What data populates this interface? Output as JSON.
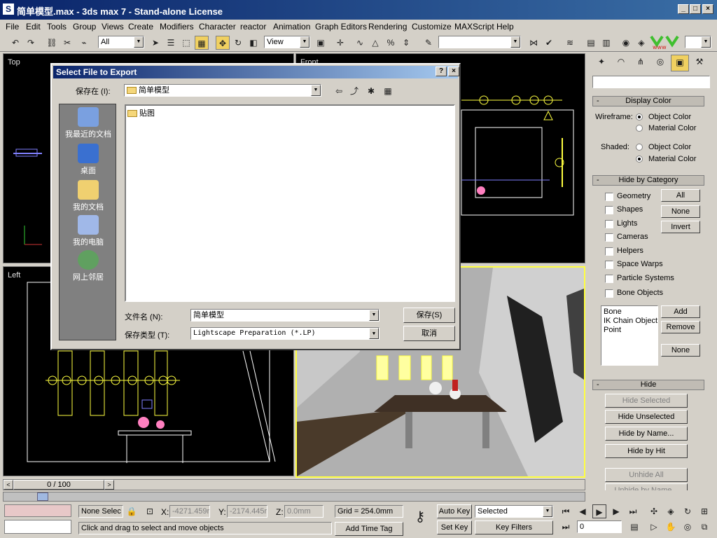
{
  "window": {
    "title": "简单模型.max - 3ds max 7 - Stand-alone License",
    "min": "_",
    "max": "□",
    "close": "×"
  },
  "menu": [
    "File",
    "Edit",
    "Tools",
    "Group",
    "Views",
    "Create",
    "Modifiers",
    "Character",
    "reactor",
    "Animation",
    "Graph Editors",
    "Rendering",
    "Customize",
    "MAXScript",
    "Help"
  ],
  "toolbar": {
    "selection_filter": "All",
    "reference_coord": "View",
    "named_selection": ""
  },
  "viewports": {
    "top": "Top",
    "front": "Front",
    "left": "Left"
  },
  "dialog": {
    "title": "Select File to Export",
    "help": "?",
    "close": "×",
    "save_in_label": "保存在 (I):",
    "save_in_value": "简单模型",
    "places": [
      "我最近的文档",
      "桌面",
      "我的文档",
      "我的电脑",
      "网上邻居"
    ],
    "files": [
      "贴图"
    ],
    "filename_label": "文件名 (N):",
    "filename_value": "简单模型",
    "filetype_label": "保存类型 (T):",
    "filetype_value": "Lightscape Preparation (*.LP)",
    "save_button": "保存(S)",
    "cancel_button": "取消"
  },
  "command_panel": {
    "display_color": {
      "title": "Display Color",
      "wireframe_label": "Wireframe:",
      "shaded_label": "Shaded:",
      "object_color": "Object Color",
      "material_color": "Material Color"
    },
    "hide_by_category": {
      "title": "Hide by Category",
      "items": [
        "Geometry",
        "Shapes",
        "Lights",
        "Cameras",
        "Helpers",
        "Space Warps",
        "Particle Systems",
        "Bone Objects"
      ],
      "all": "All",
      "none": "None",
      "invert": "Invert",
      "list": [
        "Bone",
        "IK Chain Object",
        "Point"
      ],
      "add": "Add",
      "remove": "Remove",
      "none2": "None"
    },
    "hide": {
      "title": "Hide",
      "hide_selected": "Hide Selected",
      "hide_unselected": "Hide Unselected",
      "hide_by_name": "Hide by Name...",
      "hide_by_hit": "Hide by Hit",
      "unhide_all": "Unhide All",
      "unhide_by_name": "Unhide by Name..."
    }
  },
  "timeline": {
    "frame_display": "0 / 100"
  },
  "status": {
    "selection": "None Selec",
    "x_label": "X:",
    "x_value": "-4271.459r",
    "y_label": "Y:",
    "y_value": "-2174.445r",
    "z_label": "Z:",
    "z_value": "0.0mm",
    "grid": "Grid = 254.0mm",
    "auto_key": "Auto Key",
    "set_key": "Set Key",
    "selected": "Selected",
    "key_filters": "Key Filters",
    "frame": "0",
    "prompt": "Click and drag to select and move objects",
    "add_time_tag": "Add Time Tag"
  }
}
